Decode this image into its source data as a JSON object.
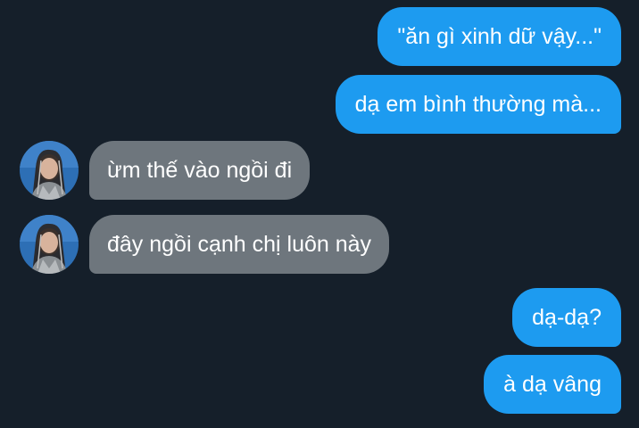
{
  "messages": [
    {
      "side": "outgoing",
      "text": "\"ăn gì xinh dữ vậy...\""
    },
    {
      "side": "outgoing",
      "text": "dạ em bình thường mà..."
    },
    {
      "side": "incoming",
      "text": "ừm thế vào ngồi đi"
    },
    {
      "side": "incoming",
      "text": "đây ngồi cạnh chị luôn này"
    },
    {
      "side": "outgoing",
      "text": "dạ-dạ?"
    },
    {
      "side": "outgoing",
      "text": "à dạ vâng"
    }
  ],
  "colors": {
    "background": "#151f2a",
    "outgoing_bubble": "#1d9bf0",
    "incoming_bubble": "#6e767d",
    "text": "#ffffff"
  }
}
